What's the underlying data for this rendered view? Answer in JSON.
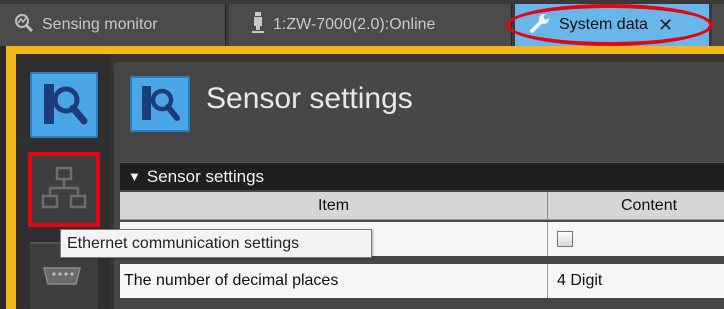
{
  "tabs": [
    {
      "label": "Sensing monitor",
      "icon": "magnifier-chart-icon"
    },
    {
      "label": "1:ZW-7000(2.0):Online",
      "icon": "sensor-probe-icon"
    },
    {
      "label": "System data",
      "icon": "wrench-icon",
      "close": "✕",
      "active": true
    }
  ],
  "sidebar": {
    "buttons": [
      {
        "name": "sensor-settings",
        "icon": "magnifier-chart-icon",
        "selected": true
      },
      {
        "name": "ethernet-communication-settings",
        "icon": "network-icon",
        "highlighted": true
      },
      {
        "name": "serial-communication-settings",
        "icon": "serial-port-icon"
      }
    ]
  },
  "tooltip": {
    "text": "Ethernet communication settings"
  },
  "main": {
    "title": "Sensor settings",
    "section": {
      "arrow": "▼",
      "label": "Sensor settings"
    },
    "table": {
      "headers": [
        "Item",
        "Content"
      ],
      "rows": [
        {
          "item": "",
          "content": "",
          "checkbox": true
        },
        {
          "item": "The number of decimal places",
          "content": "4 Digit"
        }
      ]
    }
  },
  "colors": {
    "accent_blue": "#4aa6e6",
    "active_tab": "#69b6ea",
    "frame_yellow": "#f4b71a",
    "annotation_red": "#e10612"
  }
}
